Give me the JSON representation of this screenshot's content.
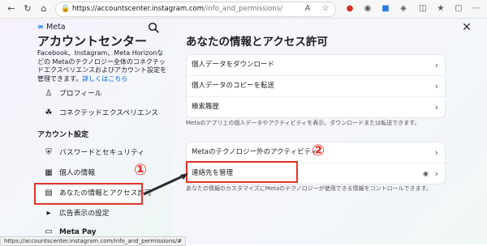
{
  "browser": {
    "url_host": "https://accountscenter.instagram.com",
    "url_path": "/info_and_permissions/",
    "status_url": "https://accountscenter.instagram.com/info_and_permissions/#"
  },
  "sidebar": {
    "brand": "Meta",
    "title": "アカウントセンター",
    "description": "Facebook、Instagram、Meta Horizonなどの Metaのテクノロジー全体のコネクテッドエクスペリエンスおよびアカウント設定を管理できます。",
    "learn_more": "詳しくはこちら",
    "items_top": [
      {
        "label": "プロフィール"
      },
      {
        "label": "コネクテッドエクスペリエンス"
      }
    ],
    "section_label": "アカウント設定",
    "items_settings": [
      {
        "label": "パスワードとセキュリティ"
      },
      {
        "label": "個人の情報"
      },
      {
        "label": "あなたの情報とアクセス許可"
      },
      {
        "label": "広告表示の設定"
      },
      {
        "label": "Meta Pay"
      }
    ]
  },
  "main": {
    "title": "あなたの情報とアクセス許可",
    "card1": [
      {
        "label": "個人データをダウンロード"
      },
      {
        "label": "個人データのコピーを転送"
      },
      {
        "label": "検索履歴"
      }
    ],
    "note1": "Metaのアプリ上の個人データやアクティビティを表示、ダウンロードまたは転送できます。",
    "card2": [
      {
        "label": "Metaのテクノロジー外のアクティビティ"
      },
      {
        "label": "連絡先を管理"
      }
    ],
    "note2": "あなたの情報のカスタマイズにMetaのテクノロジーが使用できる情報をコントロールできます。"
  },
  "annotations": {
    "marker1": "①",
    "marker2": "②"
  },
  "colors": {
    "accent": "#0064e0",
    "highlight": "#e4312b"
  }
}
